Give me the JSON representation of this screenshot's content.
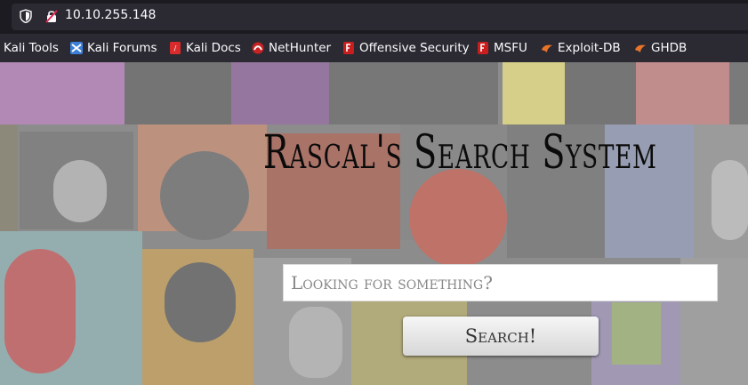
{
  "browser": {
    "url": "10.10.255.148"
  },
  "bookmarks": [
    {
      "label": "Kali Tools",
      "icon": "kali-tools-icon"
    },
    {
      "label": "Kali Forums",
      "icon": "kali-forums-icon"
    },
    {
      "label": "Kali Docs",
      "icon": "kali-docs-icon"
    },
    {
      "label": "NetHunter",
      "icon": "nethunter-icon"
    },
    {
      "label": "Offensive Security",
      "icon": "offsec-icon"
    },
    {
      "label": "MSFU",
      "icon": "msfu-icon"
    },
    {
      "label": "Exploit-DB",
      "icon": "exploit-db-icon"
    },
    {
      "label": "GHDB",
      "icon": "ghdb-icon"
    }
  ],
  "page": {
    "title": "Rascal's Search System",
    "search": {
      "placeholder": "Looking for something?",
      "value": ""
    },
    "button_label": "Search!"
  },
  "colors": {
    "chrome_bg": "#1c1b22",
    "urlbar_bg": "#2b2a33",
    "chrome_text": "#fbfbfe"
  }
}
